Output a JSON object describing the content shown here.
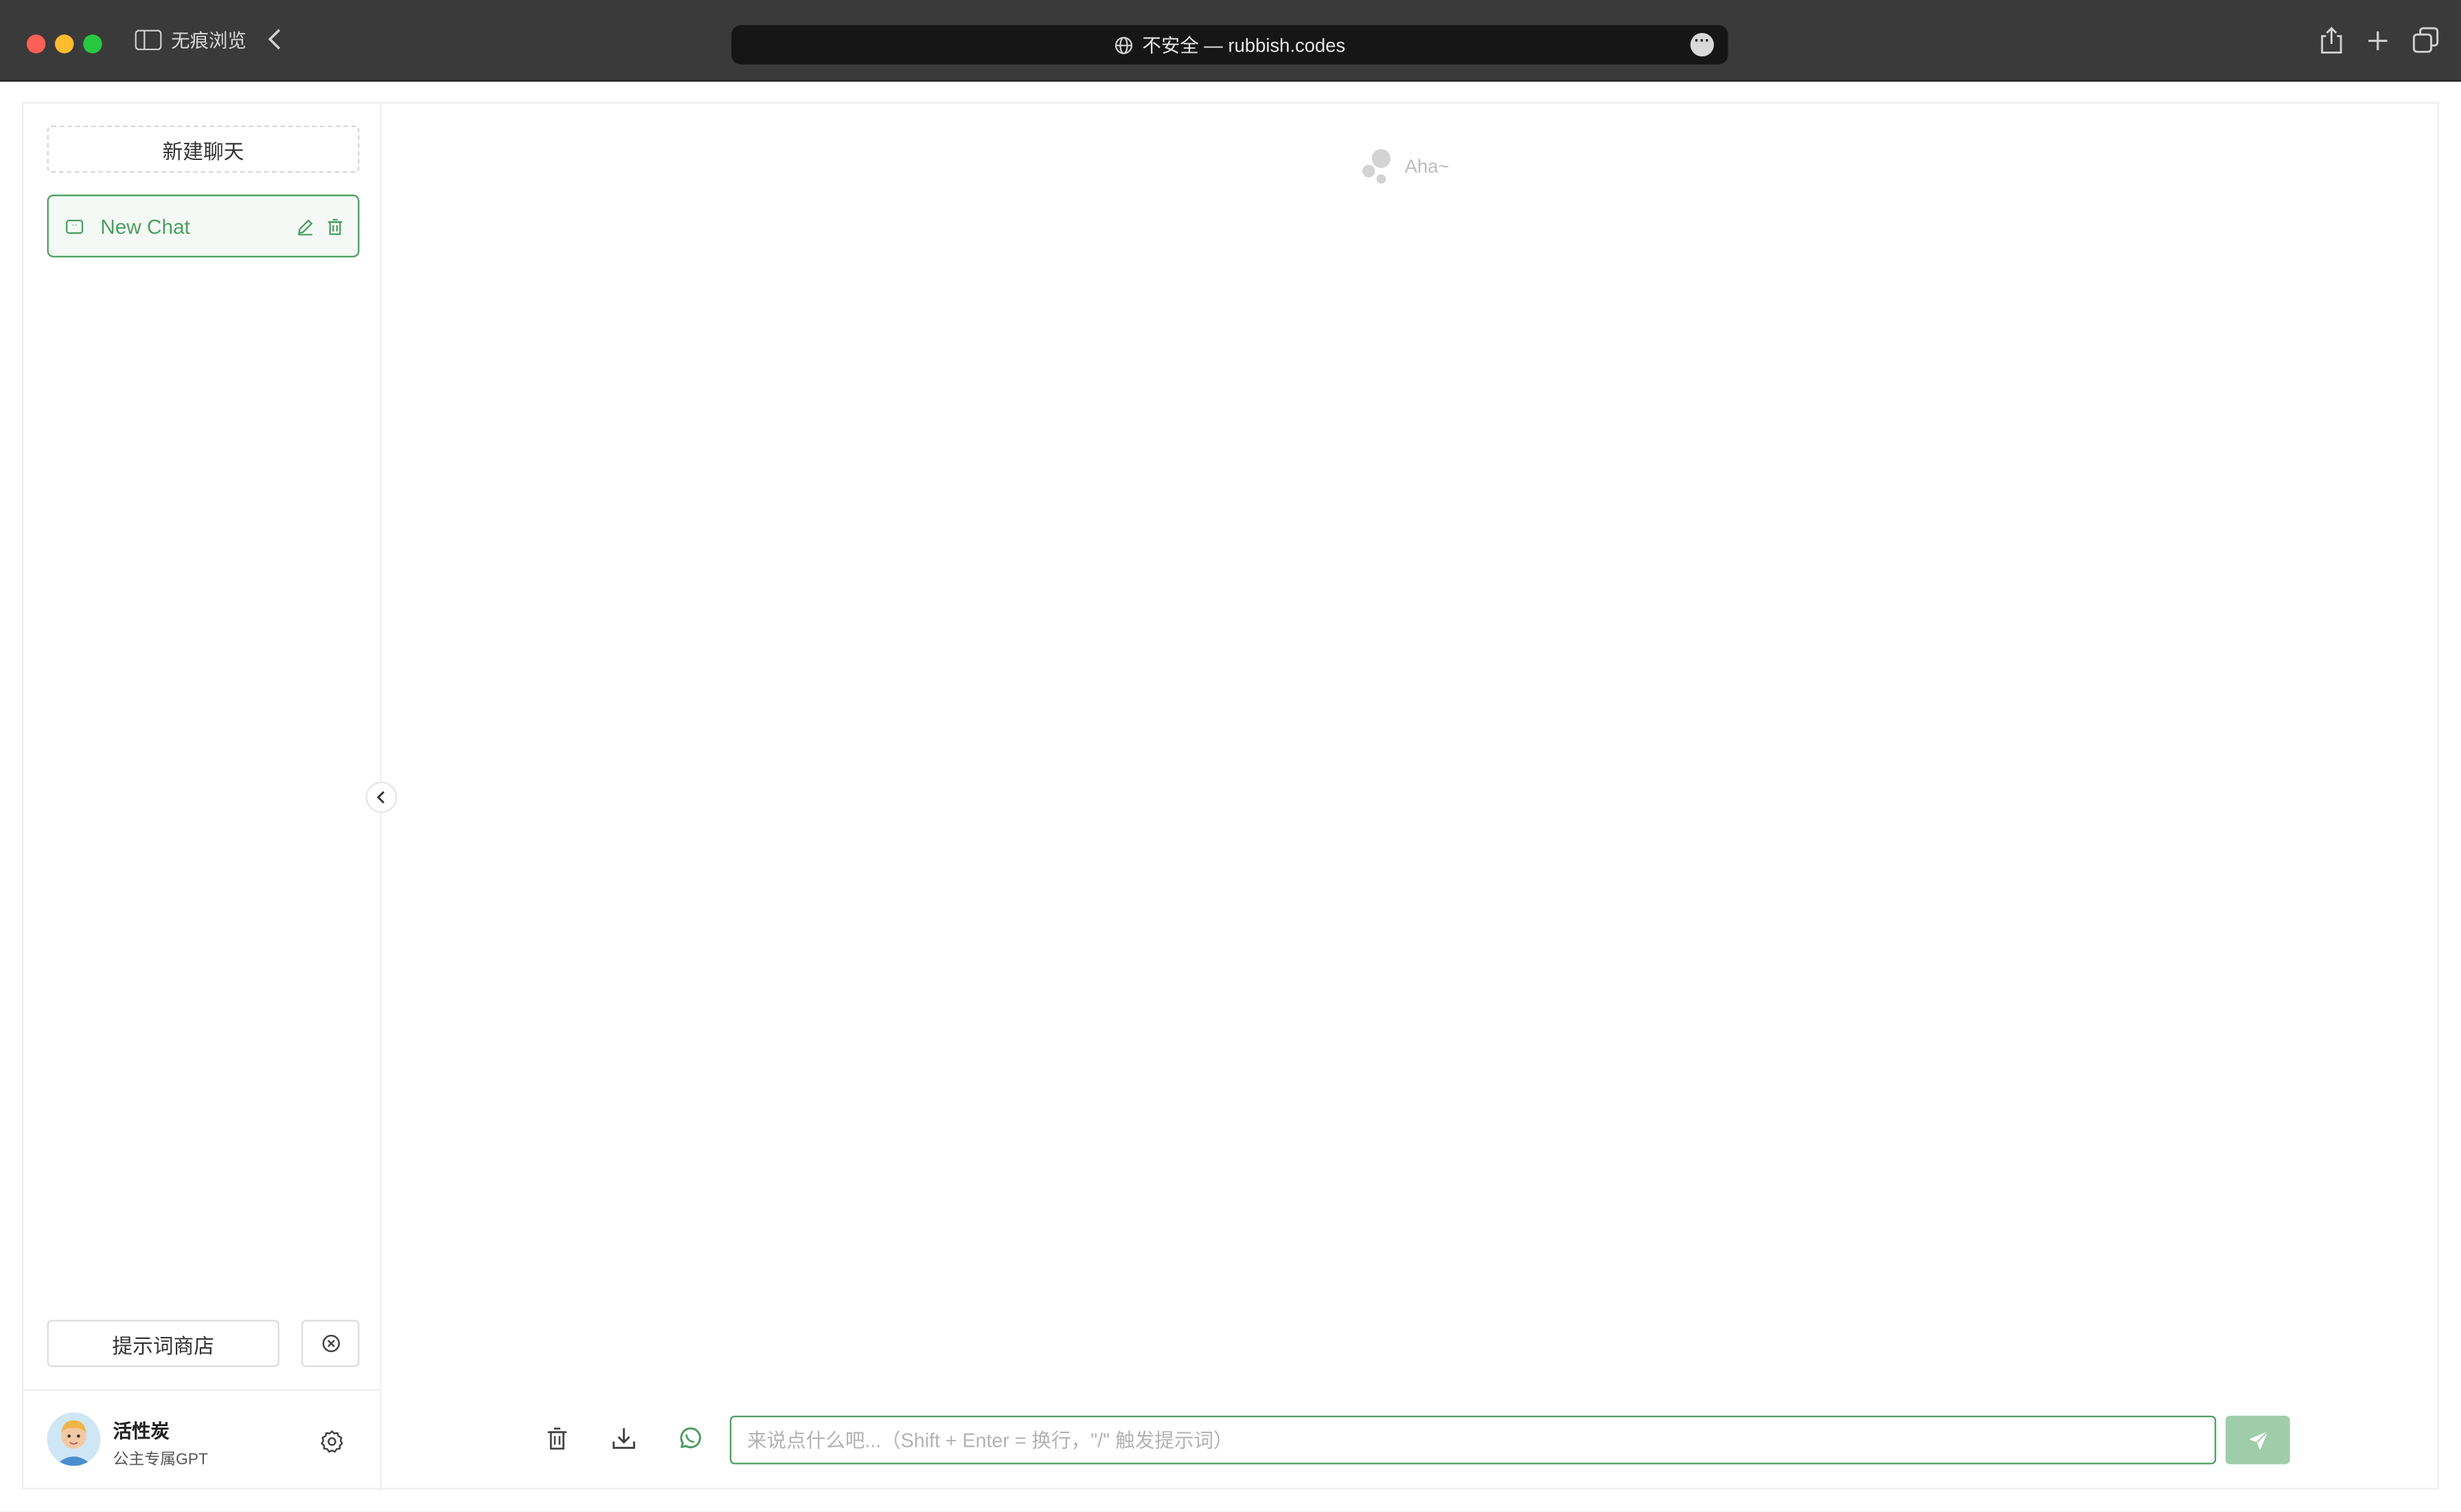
{
  "browser": {
    "private_label": "无痕浏览",
    "url_text": "不安全 — rubbish.codes",
    "colors": {
      "close": "#ff5f57",
      "minimize": "#febc2e",
      "zoom": "#28c840"
    }
  },
  "sidebar": {
    "new_chat_label": "新建聊天",
    "chats": [
      {
        "label": "New Chat",
        "icon": "chat-bubble-icon",
        "selected": true
      }
    ],
    "prompt_store_label": "提示词商店",
    "user": {
      "name": "活性炭",
      "description": "公主专属GPT"
    }
  },
  "main": {
    "empty_state_text": "Aha~",
    "input_placeholder": "来说点什么吧...（Shift + Enter = 换行，\"/\" 触发提示词）",
    "toolbar_icons": [
      "trash-icon",
      "download-icon",
      "whatsapp-icon"
    ],
    "send_icon": "paper-plane-icon"
  },
  "theme": {
    "accent": "#4b9e5f",
    "send_disabled": "#9fcdaa"
  }
}
